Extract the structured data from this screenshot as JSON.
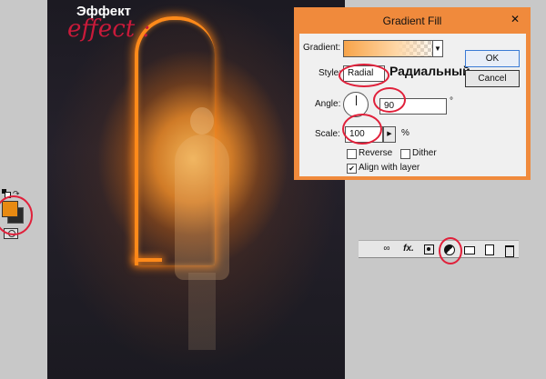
{
  "canvas": {
    "effect_ru": "Эффект",
    "effect_script": "effect :"
  },
  "tools": {
    "swatch_colors": {
      "foreground": "#e88a12",
      "background": "#2b2b2b"
    },
    "icons": [
      "reset-colors-icon",
      "swap-colors-icon",
      "quick-mask-icon"
    ]
  },
  "dialog": {
    "title": "Gradient Fill",
    "close_glyph": "✕",
    "gradient_label": "Gradient:",
    "style_label": "Style:",
    "style_value": "Radial",
    "style_note": "Радиальный",
    "angle_label": "Angle:",
    "angle_value": "90",
    "angle_unit": "°",
    "scale_label": "Scale:",
    "scale_value": "100",
    "scale_unit": "%",
    "reverse_label": "Reverse",
    "dither_label": "Dither",
    "align_label": "Align with layer",
    "align_checked": true,
    "reverse_checked": false,
    "dither_checked": false,
    "ok_label": "OK",
    "cancel_label": "Cancel",
    "accent_color": "#f08a3c"
  },
  "layers_bar": {
    "fx_label": "fx.",
    "icons": [
      "link-icon",
      "fx-icon",
      "mask-icon",
      "adjustment-layer-icon",
      "group-icon",
      "new-layer-icon",
      "trash-icon"
    ]
  }
}
